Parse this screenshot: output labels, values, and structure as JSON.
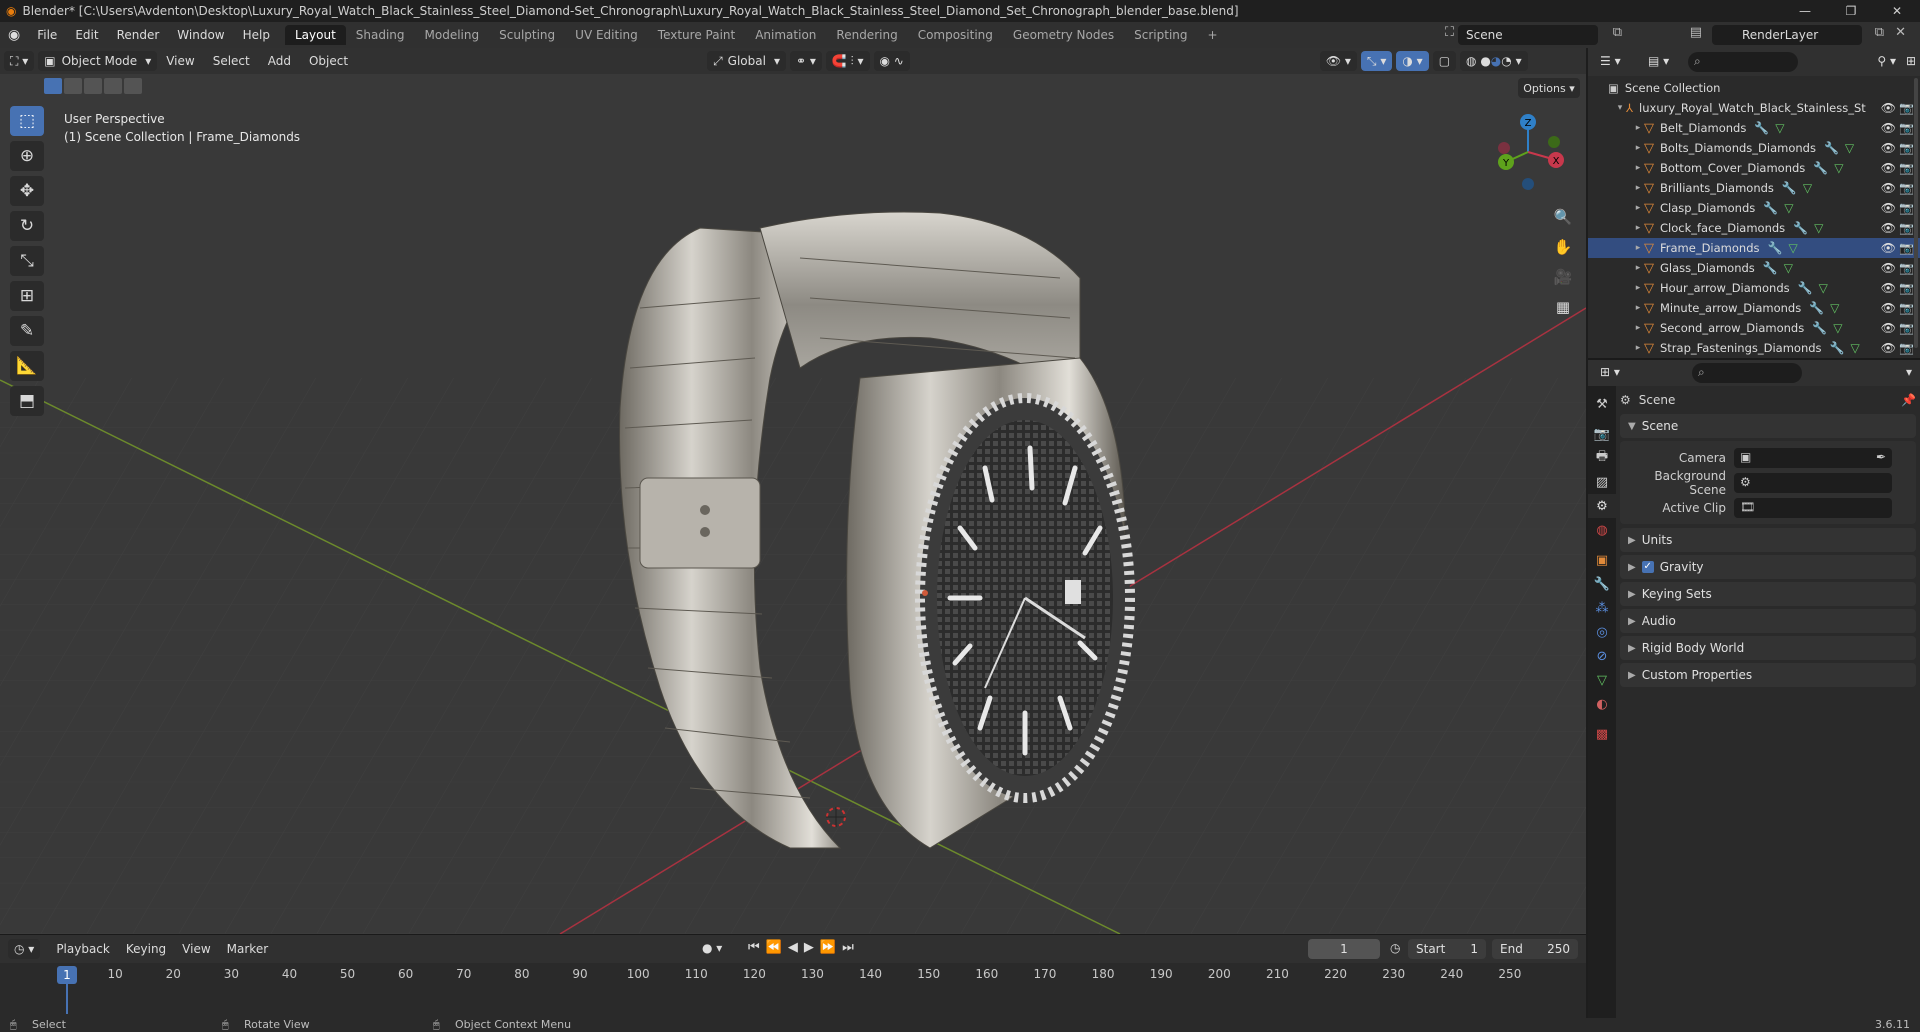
{
  "window": {
    "title": "Blender* [C:\\Users\\Avdenton\\Desktop\\Luxury_Royal_Watch_Black_Stainless_Steel_Diamond-Set_Chronograph\\Luxury_Royal_Watch_Black_Stainless_Steel_Diamond_Set_Chronograph_blender_base.blend]"
  },
  "topbar": {
    "menus": [
      "File",
      "Edit",
      "Render",
      "Window",
      "Help"
    ],
    "workspaces": [
      "Layout",
      "Shading",
      "Modeling",
      "Sculpting",
      "UV Editing",
      "Texture Paint",
      "Animation",
      "Rendering",
      "Compositing",
      "Geometry Nodes",
      "Scripting"
    ],
    "active_workspace": "Layout",
    "scene": "Scene",
    "view_layer": "RenderLayer"
  },
  "viewport": {
    "mode": "Object Mode",
    "menus": [
      "View",
      "Select",
      "Add",
      "Object"
    ],
    "transform_orientation": "Global",
    "options_label": "Options",
    "info_line1": "User Perspective",
    "info_line2": "(1) Scene Collection | Frame_Diamonds",
    "gizmo_axes": {
      "x": "X",
      "y": "Y",
      "z": "Z"
    }
  },
  "timeline": {
    "menus": [
      "Playback",
      "Keying",
      "View",
      "Marker"
    ],
    "current_frame": "1",
    "start_label": "Start",
    "start_value": "1",
    "end_label": "End",
    "end_value": "250",
    "ticks": [
      "10",
      "20",
      "30",
      "40",
      "50",
      "60",
      "70",
      "80",
      "90",
      "100",
      "110",
      "120",
      "130",
      "140",
      "150",
      "160",
      "170",
      "180",
      "190",
      "200",
      "210",
      "220",
      "230",
      "240",
      "250"
    ]
  },
  "statusbar": {
    "select": "Select",
    "rotate": "Rotate View",
    "context": "Object Context Menu",
    "version": "3.6.11"
  },
  "outliner": {
    "root": "Scene Collection",
    "collection": "luxury_Royal_Watch_Black_Stainless_St",
    "items": [
      "Belt_Diamonds",
      "Bolts_Diamonds_Diamonds",
      "Bottom_Cover_Diamonds",
      "Brilliants_Diamonds",
      "Clasp_Diamonds",
      "Clock_face_Diamonds",
      "Frame_Diamonds",
      "Glass_Diamonds",
      "Hour_arrow_Diamonds",
      "Minute_arrow_Diamonds",
      "Second_arrow_Diamonds",
      "Strap_Fastenings_Diamonds"
    ]
  },
  "properties": {
    "context_title": "Scene",
    "panel_scene": "Scene",
    "camera_label": "Camera",
    "background_label": "Background Scene",
    "clip_label": "Active Clip",
    "panels": [
      "Units",
      "Gravity",
      "Keying Sets",
      "Audio",
      "Rigid Body World",
      "Custom Properties"
    ]
  }
}
